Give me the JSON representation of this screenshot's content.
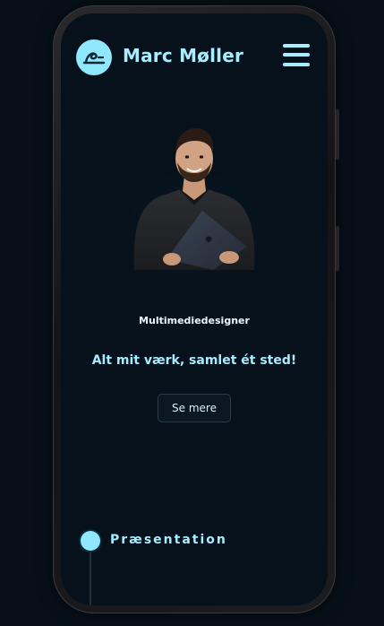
{
  "header": {
    "brand_name": "Marc Møller",
    "logo_icon": "signature-logo-icon",
    "menu_icon": "hamburger-menu-icon"
  },
  "hero": {
    "portrait": "portrait-photo",
    "title": "Multimediedesigner",
    "tagline": "Alt mit værk, samlet ét sted!",
    "cta_label": "Se mere"
  },
  "section": {
    "title": "Præsentation",
    "bullet_icon": "timeline-dot-icon"
  },
  "colors": {
    "accent": "#a9eeff",
    "background": "#06111b",
    "frame": "#1c1c1e"
  }
}
